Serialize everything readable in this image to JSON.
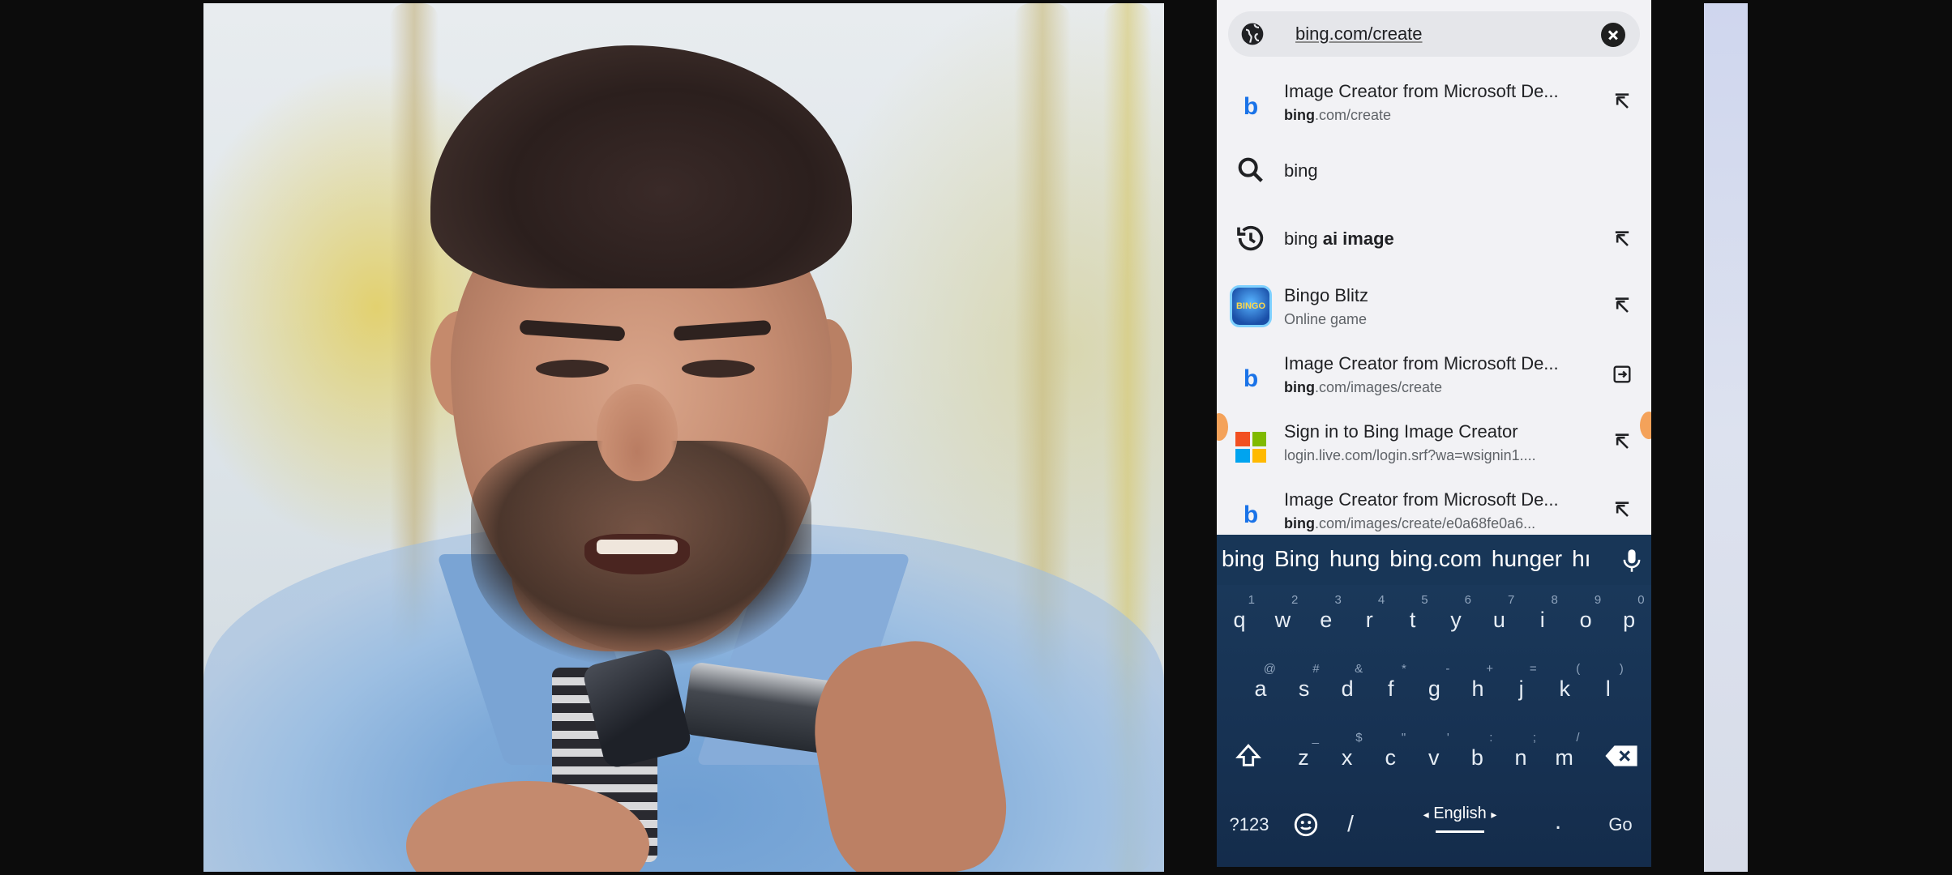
{
  "omnibox": {
    "url": "bing.com/create",
    "globe_icon": "globe-icon",
    "clear_icon": "clear-icon"
  },
  "suggestions": [
    {
      "type": "site",
      "icon": "bing-icon",
      "title": "Image Creator from Microsoft De...",
      "sub_bold": "bing",
      "sub_rest": ".com/create",
      "action_icon": "arrow-up-left-icon"
    },
    {
      "type": "search",
      "icon": "search-icon",
      "title": "bing",
      "action_icon": ""
    },
    {
      "type": "history",
      "icon": "history-icon",
      "title_plain": "bing ",
      "title_bold": "ai image",
      "action_icon": "arrow-up-left-icon"
    },
    {
      "type": "app",
      "icon": "bingo-blitz-app-icon",
      "title": "Bingo Blitz",
      "sub": "Online game",
      "action_icon": "arrow-up-left-icon"
    },
    {
      "type": "site",
      "icon": "bing-icon",
      "title": "Image Creator from Microsoft De...",
      "sub_bold": "bing",
      "sub_rest": ".com/images/create",
      "action_icon": "open-in-tab-icon"
    },
    {
      "type": "site",
      "icon": "microsoft-logo-icon",
      "title": "Sign in to Bing Image Creator",
      "sub": "login.live.com/login.srf?wa=wsignin1....",
      "action_icon": "arrow-up-left-icon"
    },
    {
      "type": "site",
      "icon": "bing-icon",
      "title": "Image Creator from Microsoft De...",
      "sub_bold": "bing",
      "sub_rest": ".com/images/create/e0a68fe0a6...",
      "action_icon": "arrow-up-left-icon"
    }
  ],
  "keyboard": {
    "suggestions": [
      "bing",
      "Bing",
      "hung",
      "bing.com",
      "hunger",
      "hı"
    ],
    "row1": [
      {
        "k": "q",
        "h": "1"
      },
      {
        "k": "w",
        "h": "2"
      },
      {
        "k": "e",
        "h": "3"
      },
      {
        "k": "r",
        "h": "4"
      },
      {
        "k": "t",
        "h": "5"
      },
      {
        "k": "y",
        "h": "6"
      },
      {
        "k": "u",
        "h": "7"
      },
      {
        "k": "i",
        "h": "8"
      },
      {
        "k": "o",
        "h": "9"
      },
      {
        "k": "p",
        "h": "0"
      }
    ],
    "row2": [
      {
        "k": "a",
        "h": "@"
      },
      {
        "k": "s",
        "h": "#"
      },
      {
        "k": "d",
        "h": "&"
      },
      {
        "k": "f",
        "h": "*"
      },
      {
        "k": "g",
        "h": "-"
      },
      {
        "k": "h",
        "h": "+"
      },
      {
        "k": "j",
        "h": "="
      },
      {
        "k": "k",
        "h": "("
      },
      {
        "k": "l",
        "h": ")"
      }
    ],
    "row3": [
      {
        "k": "z",
        "h": "_"
      },
      {
        "k": "x",
        "h": "$"
      },
      {
        "k": "c",
        "h": "\""
      },
      {
        "k": "v",
        "h": "'"
      },
      {
        "k": "b",
        "h": ":"
      },
      {
        "k": "n",
        "h": ";"
      },
      {
        "k": "m",
        "h": "/"
      }
    ],
    "symbols_label": "?123",
    "slash_label": "/",
    "language_label": "English",
    "lang_prev": "◂",
    "lang_next": "▸",
    "period_label": ".",
    "go_label": "Go",
    "shift_icon": "shift-icon",
    "backspace_icon": "backspace-icon",
    "emoji_icon": "emoji-icon",
    "mic_icon": "mic-icon"
  },
  "colors": {
    "accent": "#1a73e8",
    "keyboard_bg": "#173253",
    "screen_bg": "#f2f2f5"
  }
}
